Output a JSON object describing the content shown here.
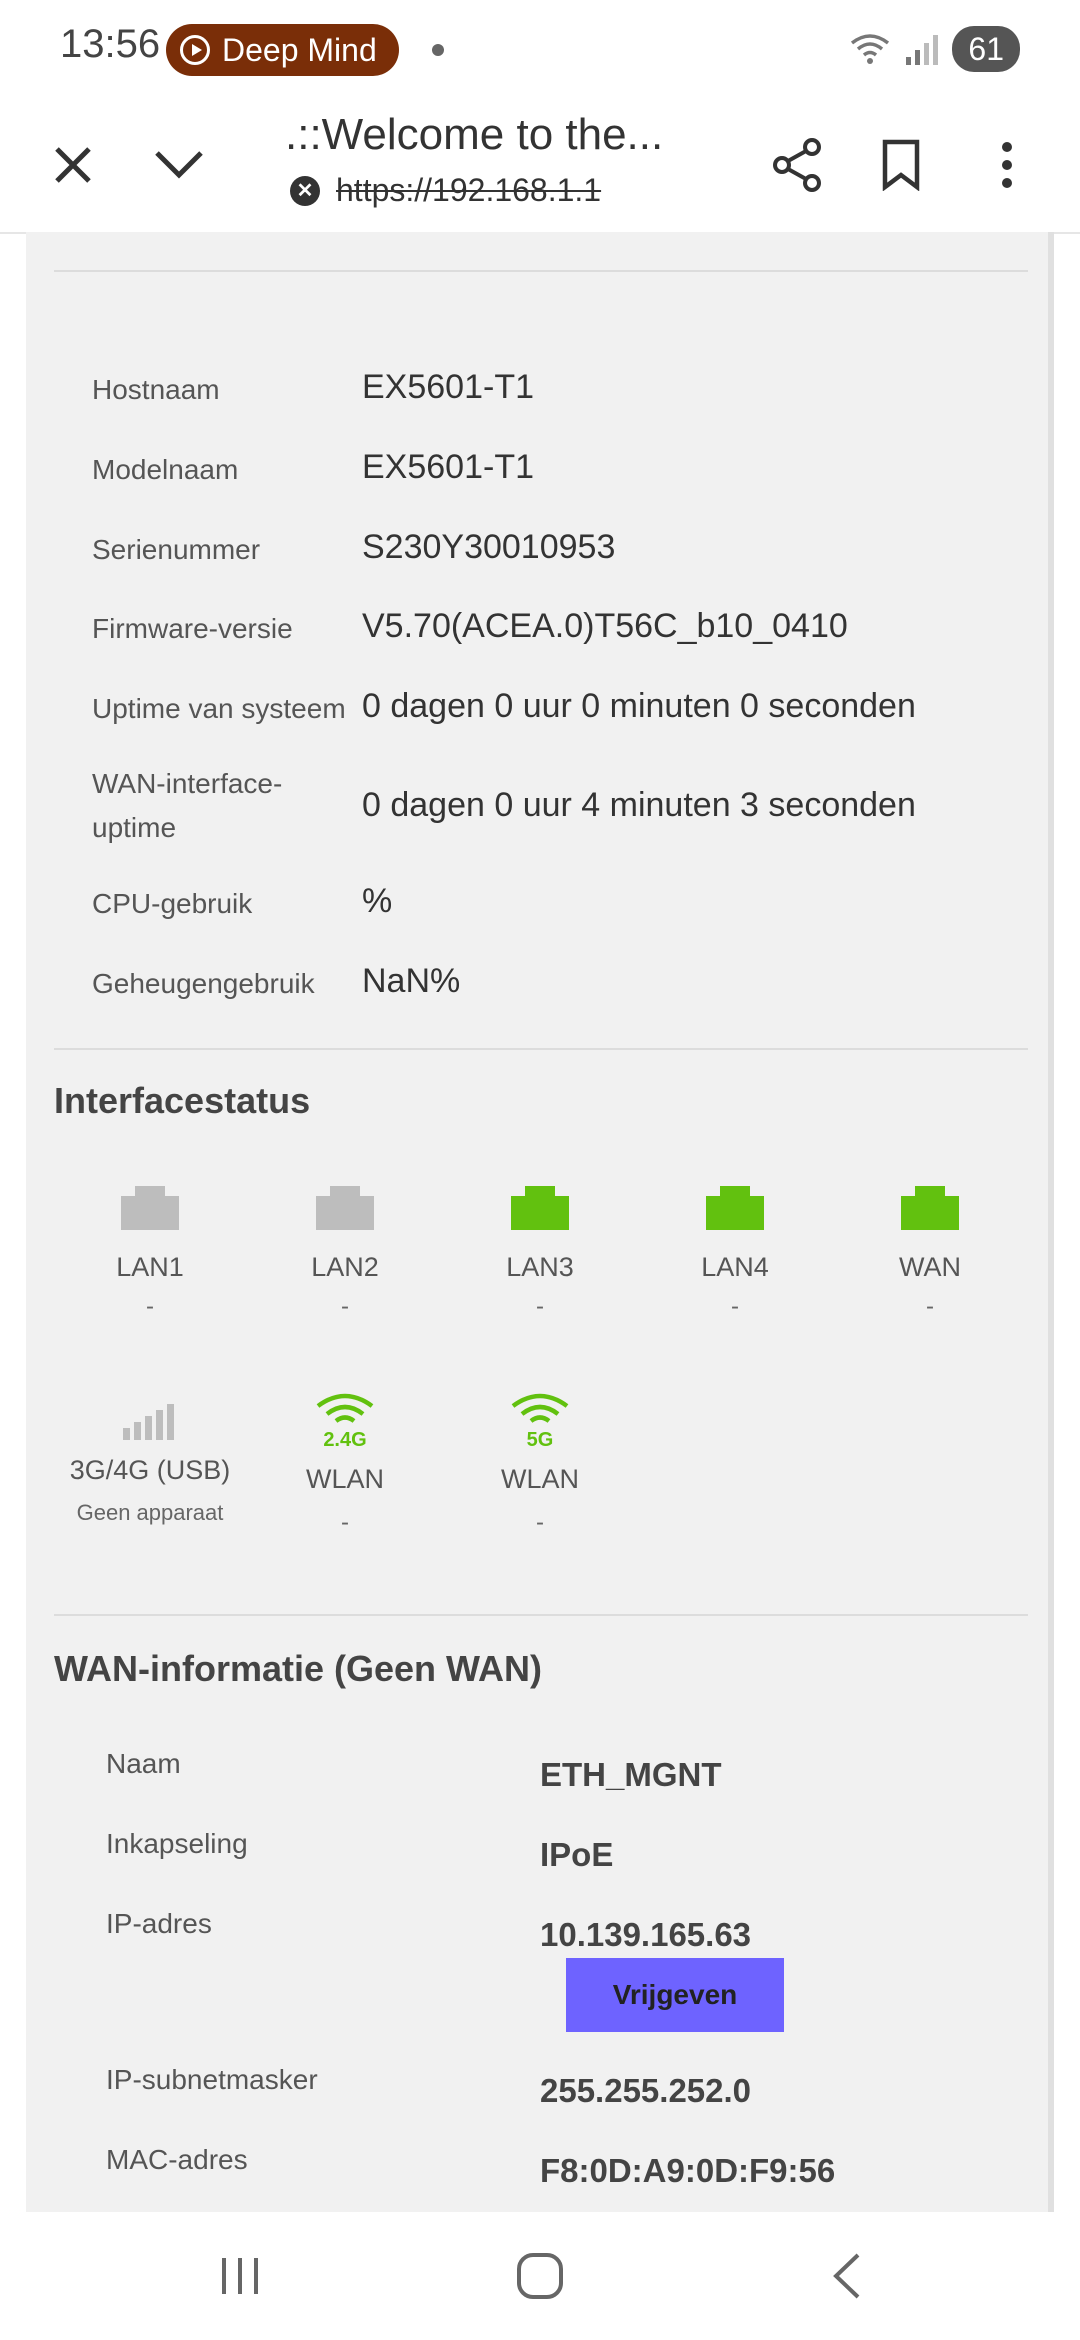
{
  "status_bar": {
    "time": "13:56",
    "notification_pill": "Deep Mind",
    "battery": "61"
  },
  "browser": {
    "title": ".::Welcome to the...",
    "url": "https://192.168.1.1"
  },
  "device_info": [
    {
      "label": "Hostnaam",
      "value": "EX5601-T1"
    },
    {
      "label": "Modelnaam",
      "value": "EX5601-T1"
    },
    {
      "label": "Serienummer",
      "value": "S230Y30010953"
    },
    {
      "label": "Firmware-versie",
      "value": "V5.70(ACEA.0)T56C_b10_0410"
    },
    {
      "label": "Uptime van systeem",
      "value": "0 dagen 0 uur 0 minuten 0 seconden"
    },
    {
      "label": "WAN-interface-uptime",
      "value": "0 dagen 0 uur 4 minuten 3 seconden"
    },
    {
      "label": "CPU-gebruik",
      "value": "%"
    },
    {
      "label": "Geheugengebruik",
      "value": "NaN%"
    }
  ],
  "interface_status": {
    "title": "Interfacestatus",
    "ports": [
      {
        "name": "LAN1",
        "status": "-",
        "color": "#bdbdbd"
      },
      {
        "name": "LAN2",
        "status": "-",
        "color": "#bdbdbd"
      },
      {
        "name": "LAN3",
        "status": "-",
        "color": "#62c10f"
      },
      {
        "name": "LAN4",
        "status": "-",
        "color": "#62c10f"
      },
      {
        "name": "WAN",
        "status": "-",
        "color": "#62c10f"
      }
    ],
    "wireless": [
      {
        "name": "3G/4G (USB)",
        "status": "Geen apparaat",
        "icon": "signal-bars-icon",
        "color": "#bdbdbd"
      },
      {
        "name": "WLAN",
        "band": "2.4G",
        "status": "-",
        "icon": "wifi-icon",
        "color": "#62c10f"
      },
      {
        "name": "WLAN",
        "band": "5G",
        "status": "-",
        "icon": "wifi-icon",
        "color": "#62c10f"
      }
    ]
  },
  "wan_info": {
    "title": "WAN-informatie (Geen WAN)",
    "rows": [
      {
        "label": "Naam",
        "value": "ETH_MGNT"
      },
      {
        "label": "Inkapseling",
        "value": "IPoE"
      },
      {
        "label": "IP-adres",
        "value": "10.139.165.63"
      },
      {
        "label": "IP-subnetmasker",
        "value": "255.255.252.0"
      },
      {
        "label": "MAC-adres",
        "value": "F8:0D:A9:0D:F9:56"
      }
    ],
    "release_button": "Vrijgeven",
    "release_color": "#6e63ff"
  }
}
